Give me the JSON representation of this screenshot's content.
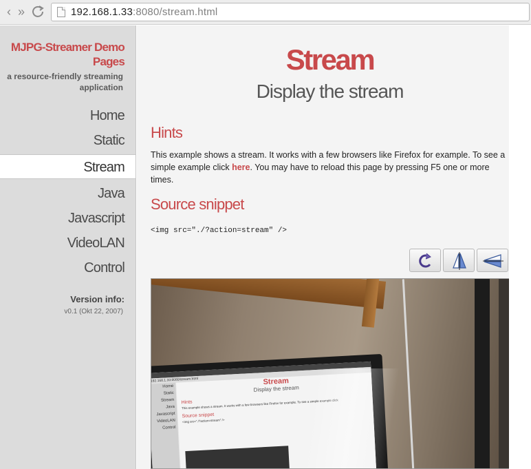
{
  "browser": {
    "url_host": "192.168.1.33",
    "url_rest": ":8080/stream.html"
  },
  "sidebar": {
    "brand": "MJPG-Streamer Demo Pages",
    "tagline": "a resource-friendly streaming application",
    "items": [
      {
        "label": "Home"
      },
      {
        "label": "Static"
      },
      {
        "label": "Stream"
      },
      {
        "label": "Java"
      },
      {
        "label": "Javascript"
      },
      {
        "label": "VideoLAN"
      },
      {
        "label": "Control"
      }
    ],
    "active_item": "Stream",
    "version_label": "Version info:",
    "version_value": "v0.1 (Okt 22, 2007)"
  },
  "main": {
    "title": "Stream",
    "subtitle": "Display the stream",
    "hints_heading": "Hints",
    "hints_text_before": "This example shows a stream. It works with a few browsers like Firefox for example. To see a simple example click ",
    "hints_link": "here",
    "hints_text_after": ". You may have to reload this page by pressing F5 one or more times.",
    "snippet_heading": "Source snippet",
    "snippet_code": "<img src=\"./?action=stream\" />"
  },
  "toolbar": {
    "buttons": [
      {
        "icon": "rotate-icon"
      },
      {
        "icon": "flip-vertical-icon"
      },
      {
        "icon": "flip-horizontal-icon"
      }
    ]
  },
  "stream_screen": {
    "title": "Stream",
    "subtitle": "Display the stream",
    "hints": "Hints",
    "snippet": "Source snippet",
    "side_items": [
      "Home",
      "Static",
      "Stream",
      "Java",
      "Javascript",
      "VideoLAN",
      "Control"
    ]
  },
  "colors": {
    "accent": "#c8494b",
    "sidebar_bg": "#dcdcdc",
    "main_bg": "#f4f4f4"
  }
}
